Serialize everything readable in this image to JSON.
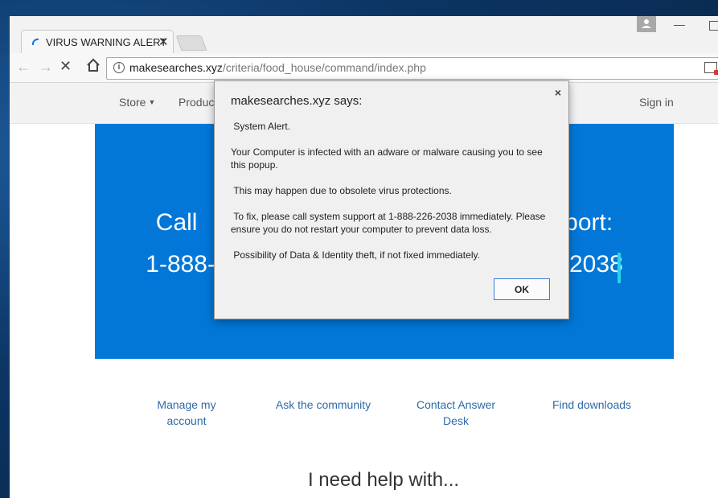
{
  "browser": {
    "tab_title": "VIRUS WARNING ALERT",
    "tab_close": "✕",
    "url_host": "makesearches.xyz",
    "url_path": "/criteria/food_house/command/index.php"
  },
  "site": {
    "nav": {
      "store": "Store",
      "products": "Produc",
      "signin": "Sign in"
    },
    "hero": {
      "line1": "Call",
      "line1_right": "pport:",
      "line2": "1-888-",
      "line2_right": "2038"
    },
    "help_links": {
      "manage": [
        "Manage my",
        "account"
      ],
      "community": "Ask the community",
      "contact": [
        "Contact Answer",
        "Desk"
      ],
      "downloads": "Find downloads"
    },
    "help_heading": "I need help with..."
  },
  "dialog": {
    "title": "makesearches.xyz says:",
    "close": "×",
    "messages": [
      " System Alert.",
      "Your Computer is infected with an adware or malware causing you to see this popup.",
      " This may happen due to obsolete virus protections.",
      " To fix, please call system support at 1-888-226-2038 immediately. Please ensure you do not restart your computer to prevent data loss.",
      " Possibility of Data & Identity theft, if not fixed immediately."
    ],
    "ok_label": "OK"
  },
  "colors": {
    "hero_bg": "#0277d8",
    "link": "#2f6aa5",
    "cursor": "#28d3e8"
  }
}
